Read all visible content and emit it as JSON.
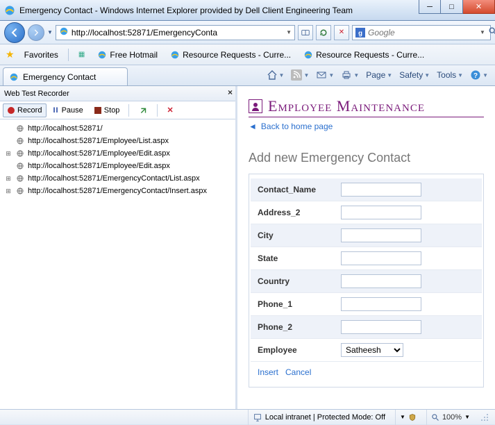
{
  "window": {
    "title": "Emergency Contact - Windows Internet Explorer provided by Dell Client Engineering Team"
  },
  "nav": {
    "url_display": "http://localhost:52871/EmergencyConta",
    "search_placeholder": "Google"
  },
  "linksbar": {
    "favorites": "Favorites",
    "items": [
      "Free Hotmail",
      "Resource Requests - Curre...",
      "Resource Requests - Curre..."
    ]
  },
  "tab": {
    "title": "Emergency Contact"
  },
  "commandbar": {
    "page": "Page",
    "safety": "Safety",
    "tools": "Tools"
  },
  "recorder": {
    "title": "Web Test Recorder",
    "record": "Record",
    "pause": "Pause",
    "stop": "Stop",
    "tree": [
      {
        "expandable": false,
        "text": "http://localhost:52871/"
      },
      {
        "expandable": false,
        "text": "http://localhost:52871/Employee/List.aspx"
      },
      {
        "expandable": true,
        "text": "http://localhost:52871/Employee/Edit.aspx"
      },
      {
        "expandable": false,
        "text": "http://localhost:52871/Employee/Edit.aspx"
      },
      {
        "expandable": true,
        "text": "http://localhost:52871/EmergencyContact/List.aspx"
      },
      {
        "expandable": true,
        "text": "http://localhost:52871/EmergencyContact/Insert.aspx"
      }
    ]
  },
  "page": {
    "app_title": "Employee Maintenance",
    "back_link": "Back to home page",
    "heading": "Add new Emergency Contact",
    "fields": {
      "contact_name": {
        "label": "Contact_Name",
        "value": ""
      },
      "address_2": {
        "label": "Address_2",
        "value": ""
      },
      "city": {
        "label": "City",
        "value": ""
      },
      "state": {
        "label": "State",
        "value": ""
      },
      "country": {
        "label": "Country",
        "value": ""
      },
      "phone_1": {
        "label": "Phone_1",
        "value": ""
      },
      "phone_2": {
        "label": "Phone_2",
        "value": ""
      },
      "employee": {
        "label": "Employee",
        "value": "Satheesh"
      }
    },
    "actions": {
      "insert": "Insert",
      "cancel": "Cancel"
    }
  },
  "status": {
    "zone": "Local intranet | Protected Mode: Off",
    "zoom": "100%"
  }
}
